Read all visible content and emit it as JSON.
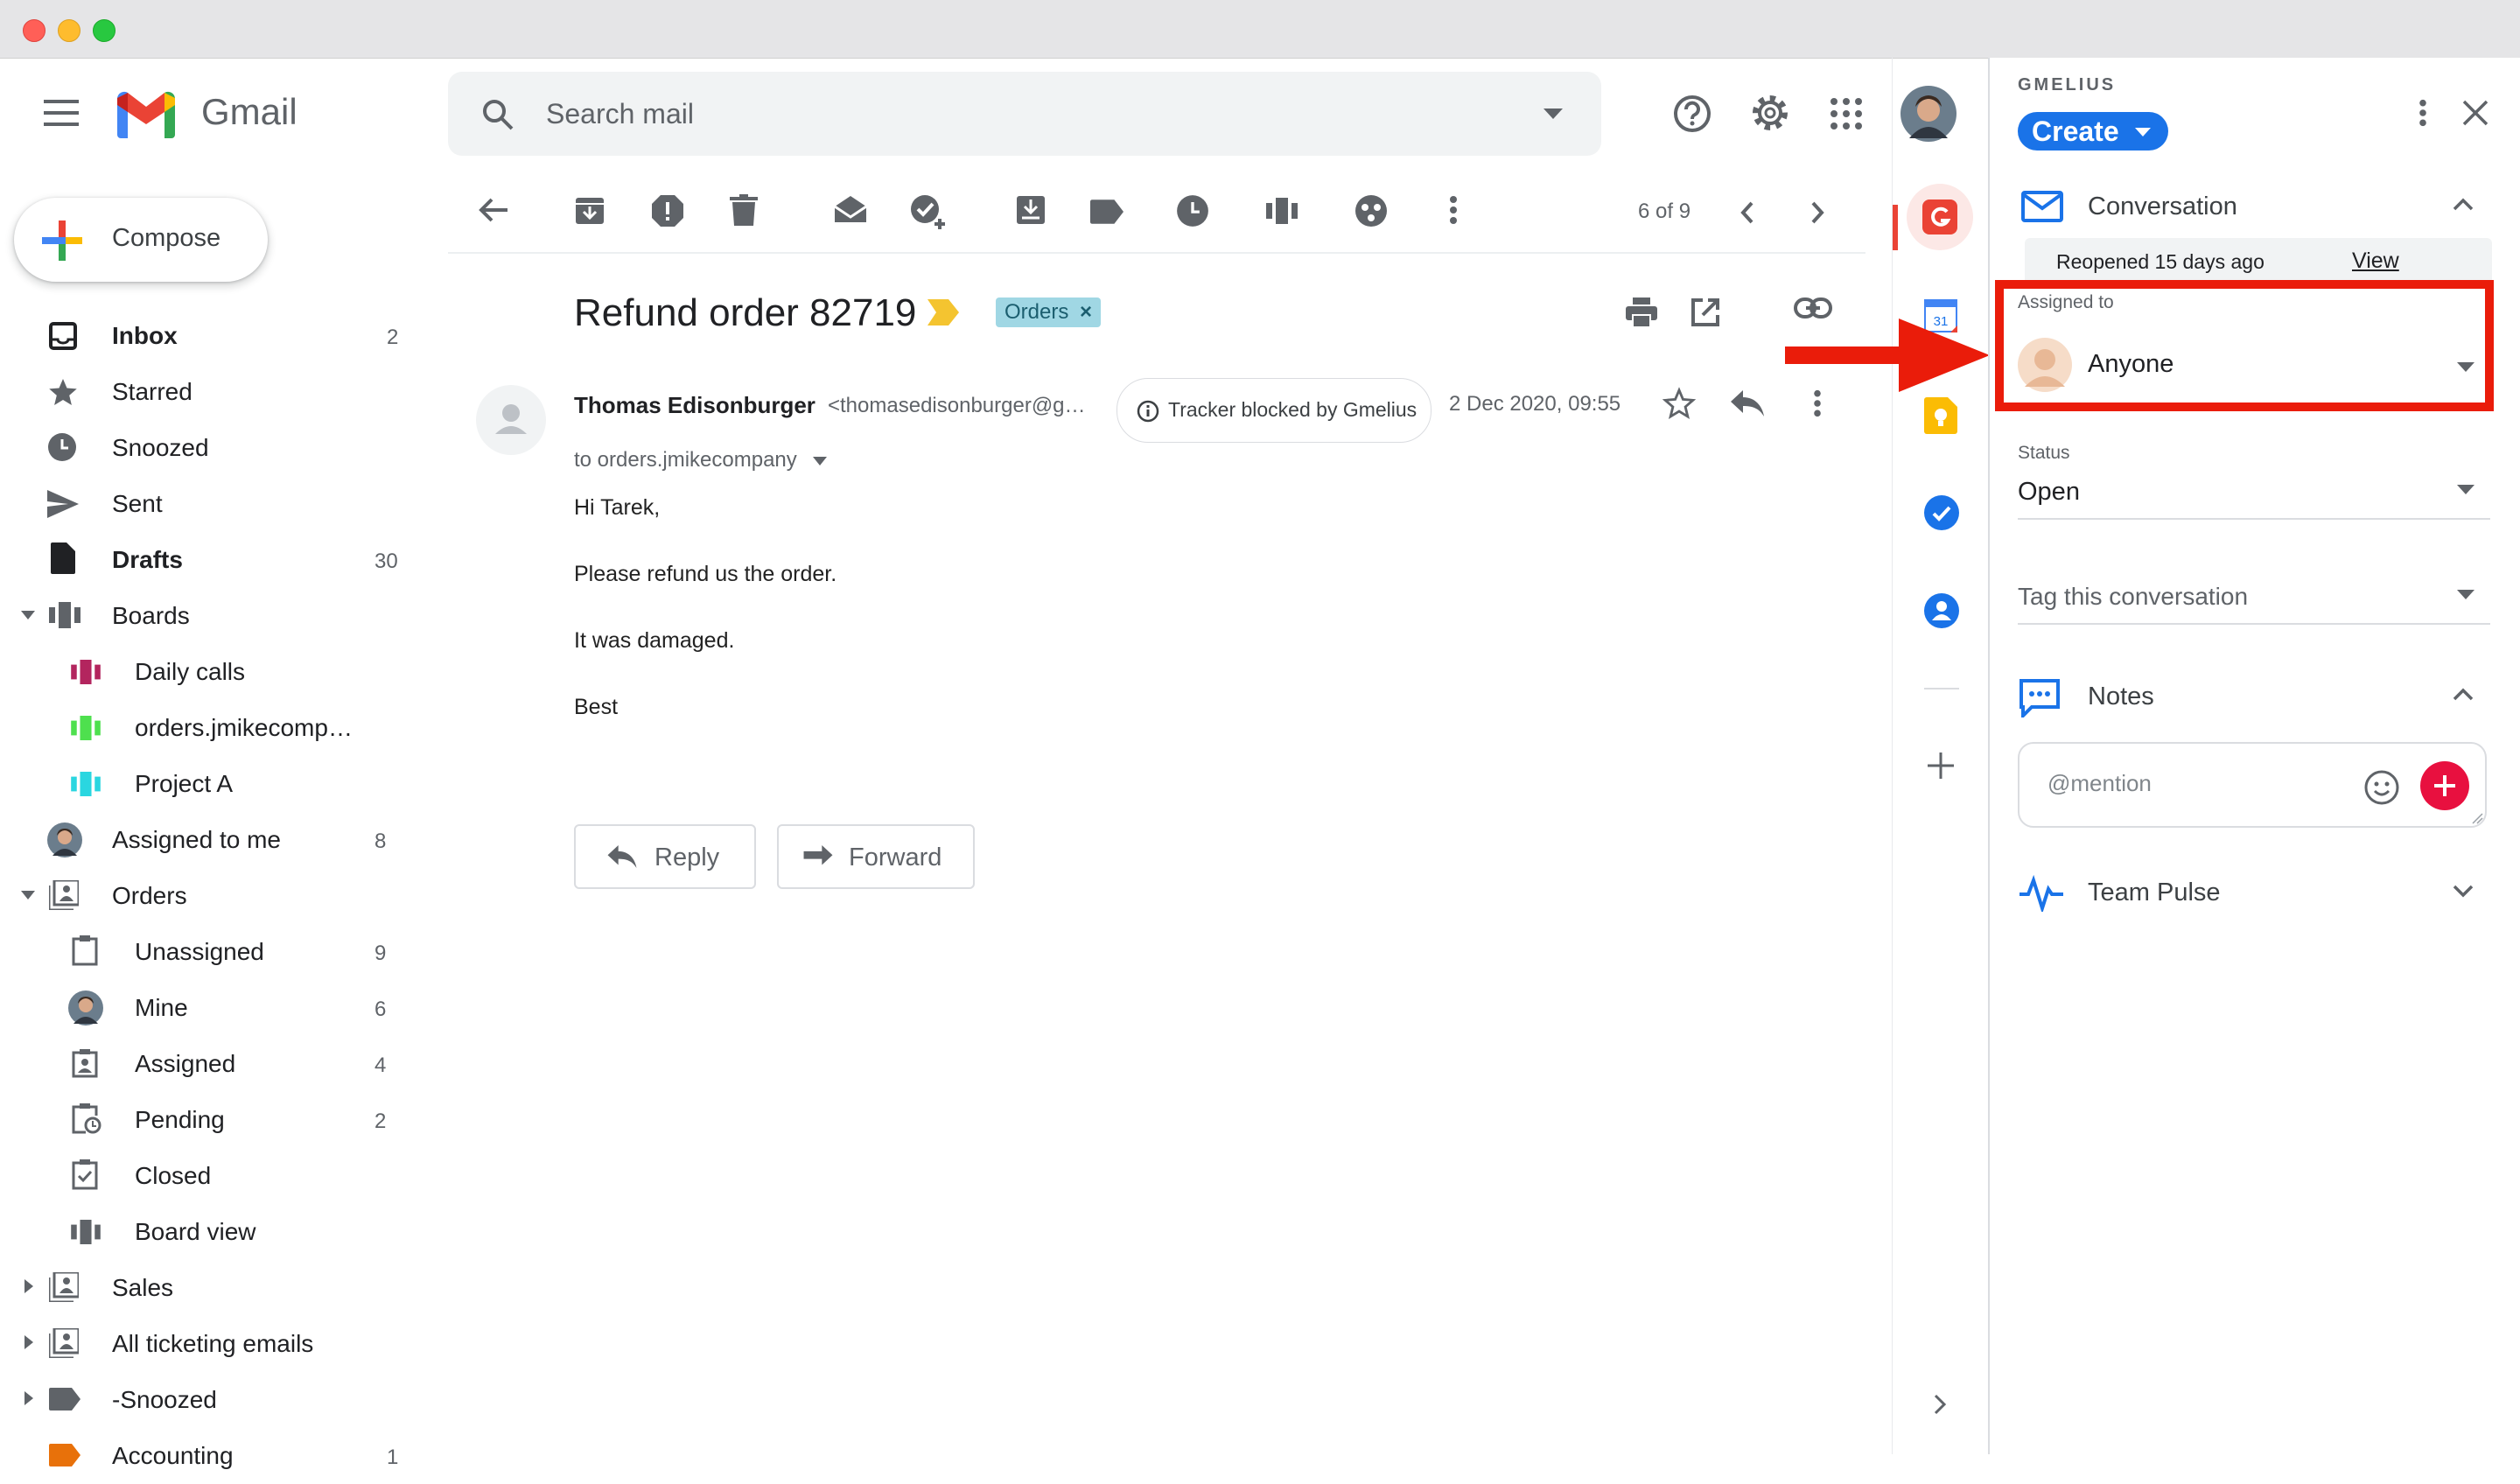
{
  "window": {
    "traffic_lights": [
      "#ff5f57",
      "#febc2e",
      "#28c840"
    ]
  },
  "header": {
    "app_name": "Gmail",
    "search_placeholder": "Search mail"
  },
  "compose": {
    "label": "Compose"
  },
  "nav": [
    {
      "label": "Inbox",
      "count": "2",
      "bold": true,
      "icon": "inbox-icon"
    },
    {
      "label": "Starred",
      "count": "",
      "icon": "star-icon"
    },
    {
      "label": "Snoozed",
      "count": "",
      "icon": "clock-icon"
    },
    {
      "label": "Sent",
      "count": "",
      "icon": "send-icon"
    },
    {
      "label": "Drafts",
      "count": "30",
      "bold": true,
      "icon": "draft-icon"
    },
    {
      "label": "Boards",
      "count": "",
      "icon": "board-icon"
    },
    {
      "label": "Daily calls",
      "count": "",
      "icon": "board-icon",
      "color": "#b3255e"
    },
    {
      "label": "orders.jmikecomp…",
      "count": "",
      "icon": "board-icon",
      "color": "#4ee04e"
    },
    {
      "label": "Project A",
      "count": "",
      "icon": "board-icon",
      "color": "#2ad6e0"
    },
    {
      "label": "Assigned to me",
      "count": "8",
      "icon": "avatar-icon"
    },
    {
      "label": "Orders",
      "count": "",
      "icon": "shared-inbox-icon"
    },
    {
      "label": "Unassigned",
      "count": "9",
      "icon": "clipboard-icon"
    },
    {
      "label": "Mine",
      "count": "6",
      "icon": "avatar-icon"
    },
    {
      "label": "Assigned",
      "count": "4",
      "icon": "assigned-icon"
    },
    {
      "label": "Pending",
      "count": "2",
      "icon": "pending-icon"
    },
    {
      "label": "Closed",
      "count": "",
      "icon": "closed-icon"
    },
    {
      "label": "Board view",
      "count": "",
      "icon": "board-icon"
    },
    {
      "label": "Sales",
      "count": "",
      "icon": "shared-inbox-icon"
    },
    {
      "label": "All ticketing emails",
      "count": "",
      "icon": "shared-inbox-icon"
    },
    {
      "label": "-Snoozed",
      "count": "",
      "icon": "label-icon"
    },
    {
      "label": "Accounting",
      "count": "1",
      "icon": "label-icon",
      "color": "#e8710a"
    }
  ],
  "toolbar": {
    "pagination": "6 of 9"
  },
  "email": {
    "subject": "Refund order 82719",
    "label_chip": "Orders",
    "sender_name": "Thomas Edisonburger",
    "sender_email": "<thomasedisonburger@g…",
    "tracker": "Tracker blocked by Gmelius",
    "date": "2 Dec 2020, 09:55",
    "to": "to orders.jmikecompany",
    "body": [
      "Hi Tarek,",
      "Please refund us the order.",
      "It was damaged.",
      "Best"
    ],
    "reply_label": "Reply",
    "forward_label": "Forward"
  },
  "panel": {
    "brand": "GMELIUS",
    "create_label": "Create",
    "conversation_title": "Conversation",
    "reopened": "Reopened 15 days ago",
    "view_link": "View",
    "assigned_label": "Assigned to",
    "assigned_value": "Anyone",
    "status_label": "Status",
    "status_value": "Open",
    "tag_placeholder": "Tag this conversation",
    "notes_title": "Notes",
    "notes_placeholder": "@mention",
    "team_pulse_title": "Team Pulse"
  },
  "colors": {
    "gmelius_blue": "#1a73e8",
    "highlight_red": "#ea1c0a",
    "add_note_red": "#e8103f"
  }
}
